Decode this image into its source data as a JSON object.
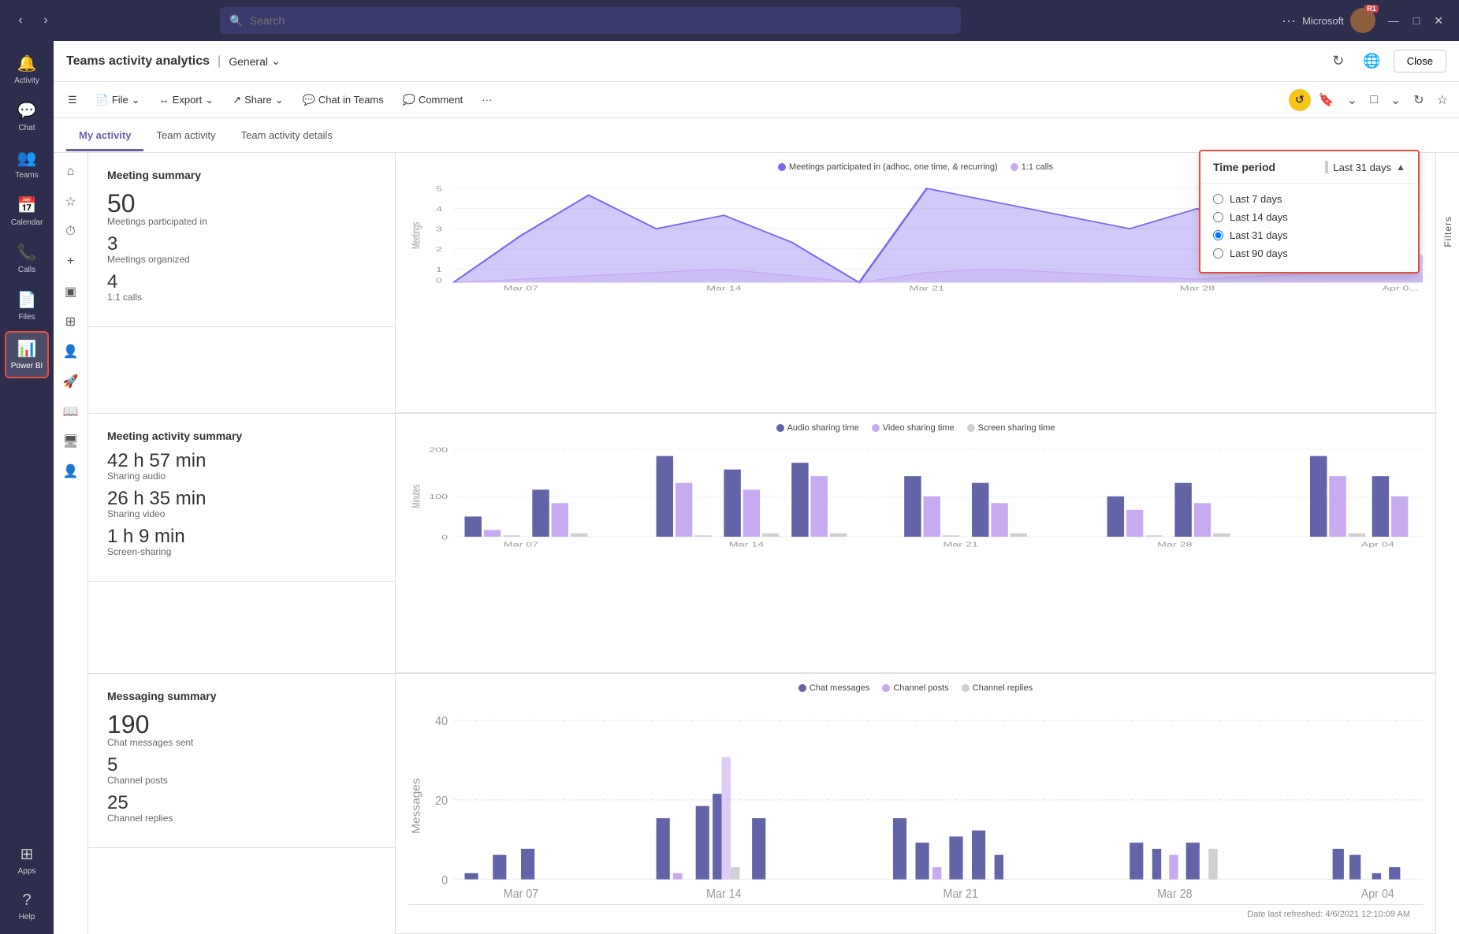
{
  "titlebar": {
    "nav_back": "‹",
    "nav_forward": "›",
    "search_placeholder": "Search",
    "more": "···",
    "microsoft": "Microsoft",
    "avatar_initials": "",
    "avatar_badge": "R1",
    "minimize": "—",
    "restore": "□",
    "close": "✕"
  },
  "sidebar": {
    "items": [
      {
        "id": "activity",
        "label": "Activity",
        "icon": "🔔"
      },
      {
        "id": "chat",
        "label": "Chat",
        "icon": "💬"
      },
      {
        "id": "teams",
        "label": "Teams",
        "icon": "👥"
      },
      {
        "id": "calendar",
        "label": "Calendar",
        "icon": "📅"
      },
      {
        "id": "calls",
        "label": "Calls",
        "icon": "📞"
      },
      {
        "id": "files",
        "label": "Files",
        "icon": "📄"
      },
      {
        "id": "powerbi",
        "label": "Power BI",
        "icon": "📊"
      },
      {
        "id": "apps",
        "label": "Apps",
        "icon": "⊞"
      },
      {
        "id": "help",
        "label": "Help",
        "icon": "?"
      }
    ],
    "more": "···"
  },
  "left_panel_icons": [
    {
      "id": "home",
      "icon": "⌂"
    },
    {
      "id": "star",
      "icon": "☆"
    },
    {
      "id": "clock",
      "icon": "○"
    },
    {
      "id": "add",
      "icon": "+"
    },
    {
      "id": "archive",
      "icon": "⊟"
    },
    {
      "id": "chart",
      "icon": "⊞"
    },
    {
      "id": "people",
      "icon": "👤"
    },
    {
      "id": "rocket",
      "icon": "🚀"
    },
    {
      "id": "book",
      "icon": "📖"
    },
    {
      "id": "monitor",
      "icon": "🖥"
    },
    {
      "id": "person2",
      "icon": "👤"
    }
  ],
  "app_header": {
    "title": "Teams activity analytics",
    "separator": "|",
    "dropdown": "General",
    "chevron": "⌄",
    "refresh_icon": "↻",
    "globe_icon": "🌐",
    "close_btn": "Close"
  },
  "toolbar": {
    "file_label": "File",
    "export_label": "Export",
    "share_label": "Share",
    "chat_in_teams": "Chat in Teams",
    "comment": "Comment",
    "more": "···",
    "undo_icon": "↺",
    "bookmark_icon": "🔖",
    "layout_icon": "□",
    "refresh_icon": "↻",
    "star_icon": "☆"
  },
  "tabs": [
    {
      "id": "my-activity",
      "label": "My activity",
      "active": true
    },
    {
      "id": "team-activity",
      "label": "Team activity",
      "active": false
    },
    {
      "id": "team-activity-details",
      "label": "Team activity details",
      "active": false
    }
  ],
  "time_period": {
    "label": "Time period",
    "selected": "Last 31 days",
    "options": [
      {
        "id": "7days",
        "label": "Last 7 days"
      },
      {
        "id": "14days",
        "label": "Last 14 days"
      },
      {
        "id": "31days",
        "label": "Last 31 days",
        "selected": true
      },
      {
        "id": "90days",
        "label": "Last 90 days"
      }
    ]
  },
  "meeting_summary": {
    "title": "Meeting summary",
    "meetings_count": "50",
    "meetings_label": "Meetings participated in",
    "organized_count": "3",
    "organized_label": "Meetings organized",
    "calls_count": "4",
    "calls_label": "1:1 calls",
    "legend": [
      {
        "label": "Meetings participated in (adhoc, one time, & recurring)",
        "color": "#7B68EE"
      },
      {
        "label": "1:1 calls",
        "color": "#c8aaf0"
      }
    ],
    "x_labels": [
      "Mar 07",
      "Mar 14",
      "Mar 21",
      "Mar 28",
      "Apr 0"
    ],
    "y_labels": [
      "0",
      "1",
      "2",
      "3",
      "4",
      "5"
    ]
  },
  "meeting_activity": {
    "title": "Meeting activity summary",
    "audio_time": "42 h 57 min",
    "audio_label": "Sharing audio",
    "video_time": "26 h 35 min",
    "video_label": "Sharing video",
    "screen_time": "1 h 9 min",
    "screen_label": "Screen-sharing",
    "legend": [
      {
        "label": "Audio sharing time",
        "color": "#6264a7"
      },
      {
        "label": "Video sharing time",
        "color": "#c8aaf0"
      },
      {
        "label": "Screen sharing time",
        "color": "#d0d0d0"
      }
    ],
    "x_labels": [
      "Mar 07",
      "Mar 14",
      "Mar 21",
      "Mar 28",
      "Apr 04"
    ],
    "y_labels": [
      "0",
      "200"
    ]
  },
  "messaging_summary": {
    "title": "Messaging summary",
    "chat_count": "190",
    "chat_label": "Chat messages sent",
    "posts_count": "5",
    "posts_label": "Channel posts",
    "replies_count": "25",
    "replies_label": "Channel replies",
    "legend": [
      {
        "label": "Chat messages",
        "color": "#6264a7"
      },
      {
        "label": "Channel posts",
        "color": "#c8aaf0"
      },
      {
        "label": "Channel replies",
        "color": "#d0d0d0"
      }
    ],
    "x_labels": [
      "Mar 07",
      "Mar 14",
      "Mar 21",
      "Mar 28",
      "Apr 04"
    ],
    "y_labels": [
      "0",
      "20",
      "40"
    ]
  },
  "date_refreshed": "Date last refreshed: 4/6/2021 12:10:09 AM",
  "filters_label": "Filters",
  "nav_arrow": "↗"
}
